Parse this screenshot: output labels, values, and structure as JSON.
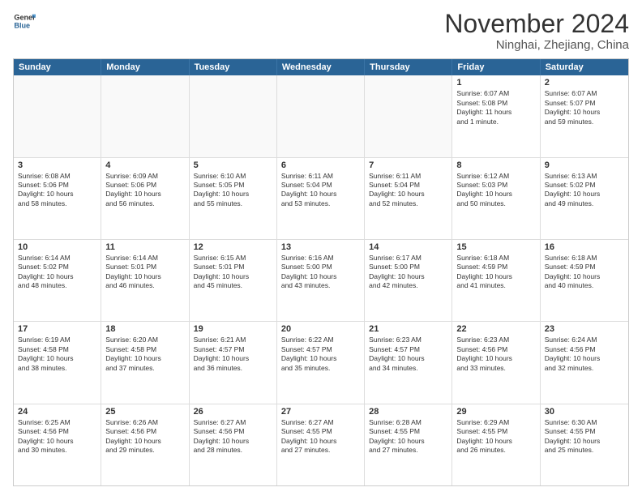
{
  "logo": {
    "line1": "General",
    "line2": "Blue"
  },
  "title": "November 2024",
  "location": "Ninghai, Zhejiang, China",
  "header_days": [
    "Sunday",
    "Monday",
    "Tuesday",
    "Wednesday",
    "Thursday",
    "Friday",
    "Saturday"
  ],
  "rows": [
    [
      {
        "day": "",
        "text": ""
      },
      {
        "day": "",
        "text": ""
      },
      {
        "day": "",
        "text": ""
      },
      {
        "day": "",
        "text": ""
      },
      {
        "day": "",
        "text": ""
      },
      {
        "day": "1",
        "text": "Sunrise: 6:07 AM\nSunset: 5:08 PM\nDaylight: 11 hours\nand 1 minute."
      },
      {
        "day": "2",
        "text": "Sunrise: 6:07 AM\nSunset: 5:07 PM\nDaylight: 10 hours\nand 59 minutes."
      }
    ],
    [
      {
        "day": "3",
        "text": "Sunrise: 6:08 AM\nSunset: 5:06 PM\nDaylight: 10 hours\nand 58 minutes."
      },
      {
        "day": "4",
        "text": "Sunrise: 6:09 AM\nSunset: 5:06 PM\nDaylight: 10 hours\nand 56 minutes."
      },
      {
        "day": "5",
        "text": "Sunrise: 6:10 AM\nSunset: 5:05 PM\nDaylight: 10 hours\nand 55 minutes."
      },
      {
        "day": "6",
        "text": "Sunrise: 6:11 AM\nSunset: 5:04 PM\nDaylight: 10 hours\nand 53 minutes."
      },
      {
        "day": "7",
        "text": "Sunrise: 6:11 AM\nSunset: 5:04 PM\nDaylight: 10 hours\nand 52 minutes."
      },
      {
        "day": "8",
        "text": "Sunrise: 6:12 AM\nSunset: 5:03 PM\nDaylight: 10 hours\nand 50 minutes."
      },
      {
        "day": "9",
        "text": "Sunrise: 6:13 AM\nSunset: 5:02 PM\nDaylight: 10 hours\nand 49 minutes."
      }
    ],
    [
      {
        "day": "10",
        "text": "Sunrise: 6:14 AM\nSunset: 5:02 PM\nDaylight: 10 hours\nand 48 minutes."
      },
      {
        "day": "11",
        "text": "Sunrise: 6:14 AM\nSunset: 5:01 PM\nDaylight: 10 hours\nand 46 minutes."
      },
      {
        "day": "12",
        "text": "Sunrise: 6:15 AM\nSunset: 5:01 PM\nDaylight: 10 hours\nand 45 minutes."
      },
      {
        "day": "13",
        "text": "Sunrise: 6:16 AM\nSunset: 5:00 PM\nDaylight: 10 hours\nand 43 minutes."
      },
      {
        "day": "14",
        "text": "Sunrise: 6:17 AM\nSunset: 5:00 PM\nDaylight: 10 hours\nand 42 minutes."
      },
      {
        "day": "15",
        "text": "Sunrise: 6:18 AM\nSunset: 4:59 PM\nDaylight: 10 hours\nand 41 minutes."
      },
      {
        "day": "16",
        "text": "Sunrise: 6:18 AM\nSunset: 4:59 PM\nDaylight: 10 hours\nand 40 minutes."
      }
    ],
    [
      {
        "day": "17",
        "text": "Sunrise: 6:19 AM\nSunset: 4:58 PM\nDaylight: 10 hours\nand 38 minutes."
      },
      {
        "day": "18",
        "text": "Sunrise: 6:20 AM\nSunset: 4:58 PM\nDaylight: 10 hours\nand 37 minutes."
      },
      {
        "day": "19",
        "text": "Sunrise: 6:21 AM\nSunset: 4:57 PM\nDaylight: 10 hours\nand 36 minutes."
      },
      {
        "day": "20",
        "text": "Sunrise: 6:22 AM\nSunset: 4:57 PM\nDaylight: 10 hours\nand 35 minutes."
      },
      {
        "day": "21",
        "text": "Sunrise: 6:23 AM\nSunset: 4:57 PM\nDaylight: 10 hours\nand 34 minutes."
      },
      {
        "day": "22",
        "text": "Sunrise: 6:23 AM\nSunset: 4:56 PM\nDaylight: 10 hours\nand 33 minutes."
      },
      {
        "day": "23",
        "text": "Sunrise: 6:24 AM\nSunset: 4:56 PM\nDaylight: 10 hours\nand 32 minutes."
      }
    ],
    [
      {
        "day": "24",
        "text": "Sunrise: 6:25 AM\nSunset: 4:56 PM\nDaylight: 10 hours\nand 30 minutes."
      },
      {
        "day": "25",
        "text": "Sunrise: 6:26 AM\nSunset: 4:56 PM\nDaylight: 10 hours\nand 29 minutes."
      },
      {
        "day": "26",
        "text": "Sunrise: 6:27 AM\nSunset: 4:56 PM\nDaylight: 10 hours\nand 28 minutes."
      },
      {
        "day": "27",
        "text": "Sunrise: 6:27 AM\nSunset: 4:55 PM\nDaylight: 10 hours\nand 27 minutes."
      },
      {
        "day": "28",
        "text": "Sunrise: 6:28 AM\nSunset: 4:55 PM\nDaylight: 10 hours\nand 27 minutes."
      },
      {
        "day": "29",
        "text": "Sunrise: 6:29 AM\nSunset: 4:55 PM\nDaylight: 10 hours\nand 26 minutes."
      },
      {
        "day": "30",
        "text": "Sunrise: 6:30 AM\nSunset: 4:55 PM\nDaylight: 10 hours\nand 25 minutes."
      }
    ]
  ]
}
